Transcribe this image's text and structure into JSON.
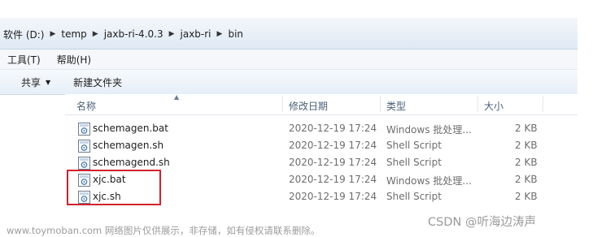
{
  "address": {
    "crumbs": [
      "软件 (D:)",
      "temp",
      "jaxb-ri-4.0.3",
      "jaxb-ri",
      "bin"
    ]
  },
  "menubar": {
    "items": [
      "工具(T)",
      "帮助(H)"
    ]
  },
  "toolbar": {
    "share_label": "共享",
    "new_folder_label": "新建文件夹"
  },
  "columns": {
    "name": "名称",
    "date": "修改日期",
    "type": "类型",
    "size": "大小"
  },
  "files": [
    {
      "name": "schemagen.bat",
      "date": "2020-12-19 17:24",
      "type": "Windows 批处理...",
      "size": "2 KB"
    },
    {
      "name": "schemagen.sh",
      "date": "2020-12-19 17:24",
      "type": "Shell Script",
      "size": "2 KB"
    },
    {
      "name": "schemagend.sh",
      "date": "2020-12-19 17:24",
      "type": "Shell Script",
      "size": "2 KB"
    },
    {
      "name": "xjc.bat",
      "date": "2020-12-19 17:24",
      "type": "Windows 批处理...",
      "size": "2 KB"
    },
    {
      "name": "xjc.sh",
      "date": "2020-12-19 17:24",
      "type": "Shell Script",
      "size": "2 KB"
    }
  ],
  "overlays": {
    "watermark_text": "www.toymoban.com 网络图片仅供展示，非存储，如有侵权请联系删除。",
    "csdn_text": "CSDN @听海边涛声",
    "highlight_color": "#d3212d"
  },
  "icons": {
    "file": "script-file-icon",
    "crumb_separator": "chevron-right-icon",
    "share_caret": "caret-down-icon",
    "sort": "sort-up-icon"
  }
}
